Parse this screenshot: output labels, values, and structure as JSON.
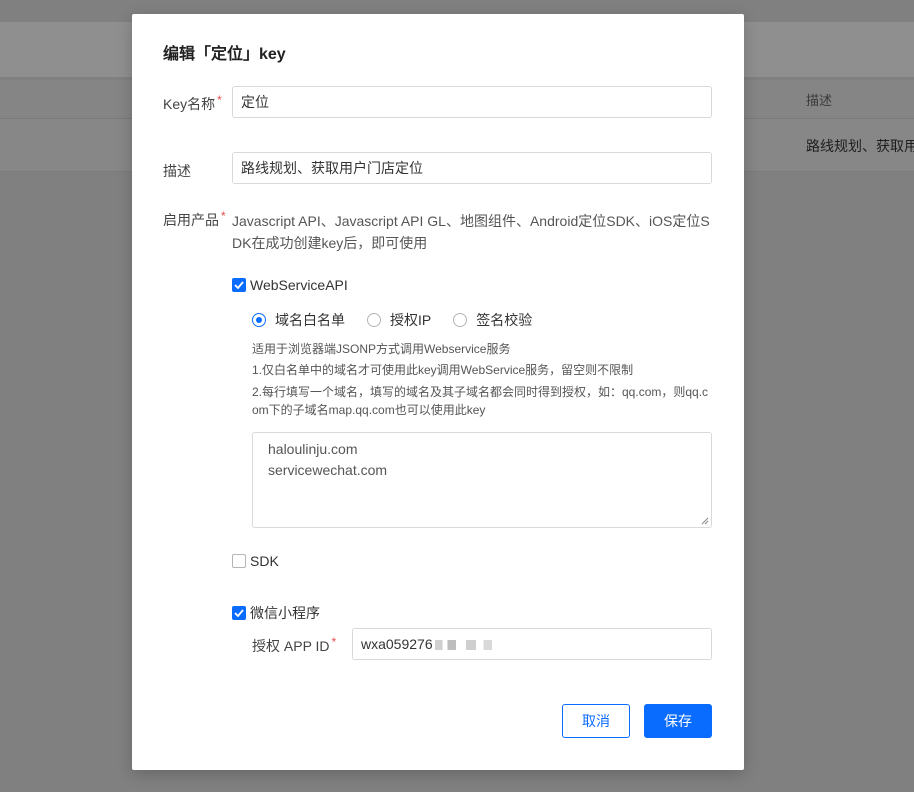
{
  "background": {
    "table_header_col": "描述",
    "table_row_cell": "路线规划、获取用"
  },
  "modal": {
    "title": "编辑「定位」key",
    "fields": {
      "key_name_label": "Key名称",
      "key_name_value": "定位",
      "desc_label": "描述",
      "desc_value": "路线规划、获取用户门店定位",
      "products_label": "启用产品",
      "products_text": "Javascript API、Javascript API GL、地图组件、Android定位SDK、iOS定位SDK在成功创建key后，即可使用"
    },
    "webservice": {
      "label": "WebServiceAPI",
      "checked": true,
      "radios": [
        {
          "label": "域名白名单",
          "selected": true
        },
        {
          "label": "授权IP",
          "selected": false
        },
        {
          "label": "签名校验",
          "selected": false
        }
      ],
      "hints": [
        "适用于浏览器端JSONP方式调用Webservice服务",
        "1.仅白名单中的域名才可使用此key调用WebService服务，留空则不限制",
        "2.每行填写一个域名，填写的域名及其子域名都会同时得到授权，如：qq.com，则qq.com下的子域名map.qq.com也可以使用此key"
      ],
      "domains": [
        "haloulinju.com",
        "servicewechat.com"
      ]
    },
    "sdk": {
      "label": "SDK",
      "checked": false
    },
    "miniprogram": {
      "label": "微信小程序",
      "checked": true,
      "appid_label": "授权 APP ID",
      "appid_value": "wxa059276"
    },
    "buttons": {
      "cancel": "取消",
      "save": "保存"
    }
  },
  "colors": {
    "primary": "#0a6cff",
    "required": "#e84c4c",
    "overlay": "#808080"
  }
}
